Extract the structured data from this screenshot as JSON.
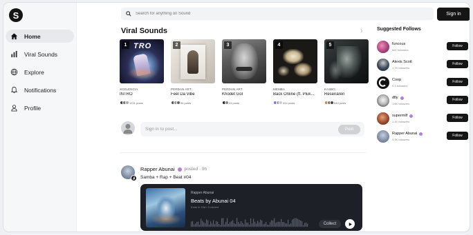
{
  "brand": {
    "logo_letter": "S"
  },
  "nav": [
    {
      "label": "Home",
      "icon": "home-icon",
      "active": true
    },
    {
      "label": "Viral Sounds",
      "icon": "chart-icon",
      "active": false
    },
    {
      "label": "Explore",
      "icon": "globe-icon",
      "active": false
    },
    {
      "label": "Notifications",
      "icon": "bell-icon",
      "active": false
    },
    {
      "label": "Profile",
      "icon": "user-icon",
      "active": false
    }
  ],
  "topbar": {
    "search_placeholder": "Search for anything on Sound",
    "signin_label": "Sign in"
  },
  "viral": {
    "title": "Viral Sounds",
    "tracks": [
      {
        "rank": "1",
        "artist": "XCELENCIA",
        "title": "INTRO",
        "posts": "1221 posts"
      },
      {
        "rank": "2",
        "artist": "PERDAN ART",
        "title": "Feel Da Vibe",
        "posts": "96 posts"
      },
      {
        "rank": "3",
        "artist": "PERDAN ART",
        "title": "Khodet Gol",
        "posts": "41 posts"
      },
      {
        "rank": "4",
        "artist": "MEMBA",
        "title": "Back Online (ft. Pluk...",
        "posts": "414 posts"
      },
      {
        "rank": "5",
        "artist": "KASBO",
        "title": "Resenären",
        "posts": "543 posts"
      }
    ]
  },
  "composer": {
    "placeholder": "Sign in to post...",
    "post_label": "Post"
  },
  "feed": {
    "author": "Rapper Abunai",
    "meta": "posted · 9h",
    "text": "Samba + Rap + Beat #04",
    "player": {
      "artist": "Rapper Abunai",
      "title": "Beats by Abunai 04",
      "sub": "Ends in 15d • 3 minted",
      "collect_label": "Collect"
    }
  },
  "suggested": {
    "title": "Suggested Follows",
    "follow_label": "Follow",
    "items": [
      {
        "name": "funcous",
        "followers": "661 followers",
        "verified": false
      },
      {
        "name": "Alexis Scott",
        "followers": "1.7K followers",
        "verified": false
      },
      {
        "name": "Coop",
        "followers": "9.1 followers",
        "verified": false
      },
      {
        "name": "dfly",
        "followers": "1.6K followers",
        "verified": true
      },
      {
        "name": "supermilf",
        "followers": "1.1K followers",
        "verified": true
      },
      {
        "name": "Rapper Abunai",
        "followers": "3.9K followers",
        "verified": true
      }
    ]
  },
  "colors": {
    "accent_verified": "#b57edc",
    "dark": "#151515",
    "player_bg": "#1d2026"
  }
}
